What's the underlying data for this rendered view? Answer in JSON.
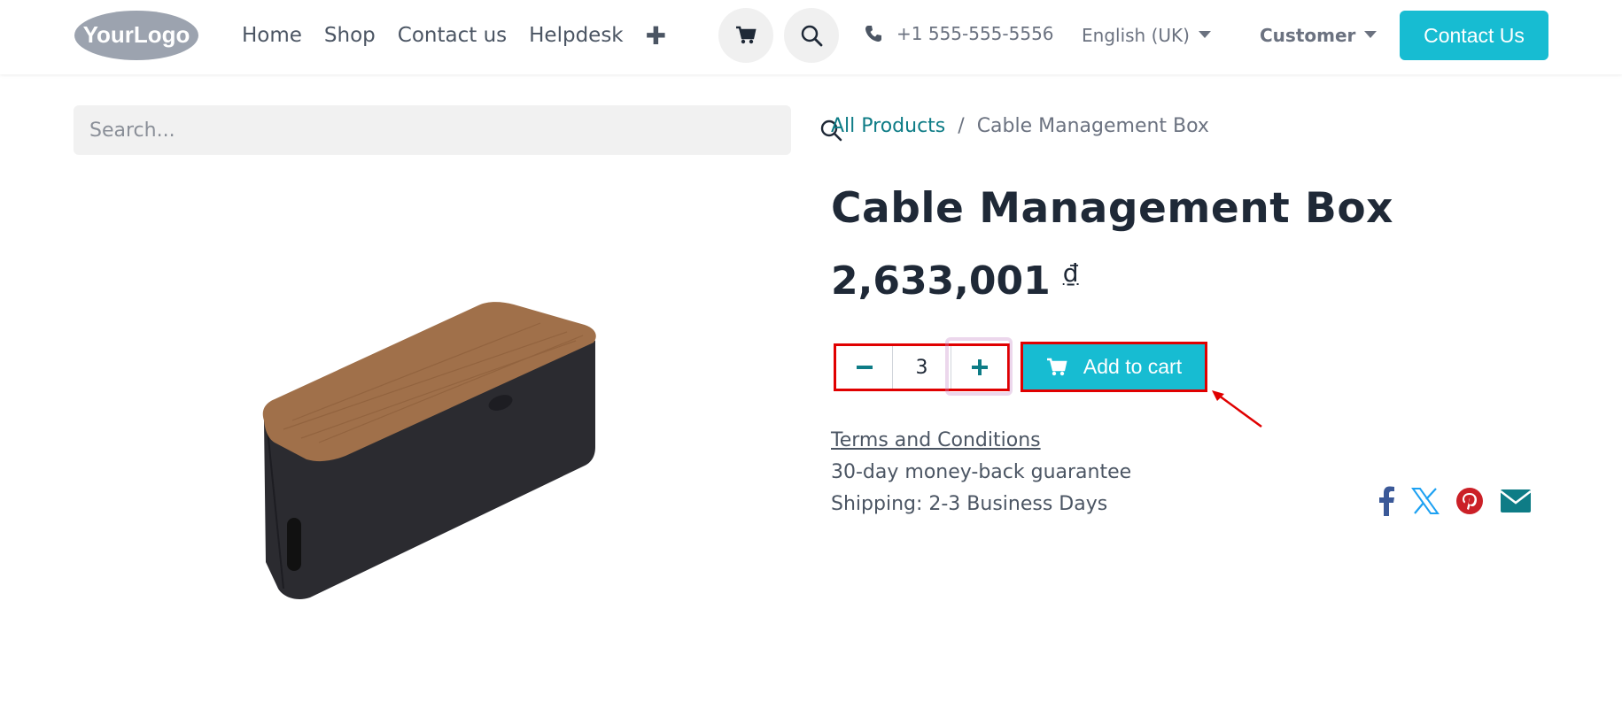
{
  "header": {
    "logo_text": "YourLogo",
    "nav": [
      "Home",
      "Shop",
      "Contact us",
      "Helpdesk"
    ],
    "phone": "+1 555-555-5556",
    "language": "English (UK)",
    "user": "Customer",
    "contact_button": "Contact Us"
  },
  "search": {
    "placeholder": "Search..."
  },
  "breadcrumb": {
    "parent": "All Products",
    "separator": "/",
    "current": "Cable Management Box"
  },
  "product": {
    "title": "Cable Management Box",
    "price": "2,633,001",
    "currency": "₫",
    "quantity": "3",
    "add_to_cart": "Add to cart"
  },
  "info": {
    "terms": "Terms and Conditions",
    "guarantee": "30-day money-back guarantee",
    "shipping": "Shipping: 2-3 Business Days"
  },
  "icons": {
    "cart": "cart-icon",
    "search": "search-icon",
    "phone": "phone-icon",
    "plus": "plus-icon",
    "minus": "minus-icon",
    "facebook": "facebook-icon",
    "x": "x-icon",
    "pinterest": "pinterest-icon",
    "email": "email-icon"
  },
  "colors": {
    "accent": "#17bcd2",
    "link": "#0e7c86",
    "highlight": "#e00000",
    "facebook": "#3b5998",
    "x": "#1da1f2",
    "pinterest": "#cb2027",
    "email": "#0e7c86"
  }
}
